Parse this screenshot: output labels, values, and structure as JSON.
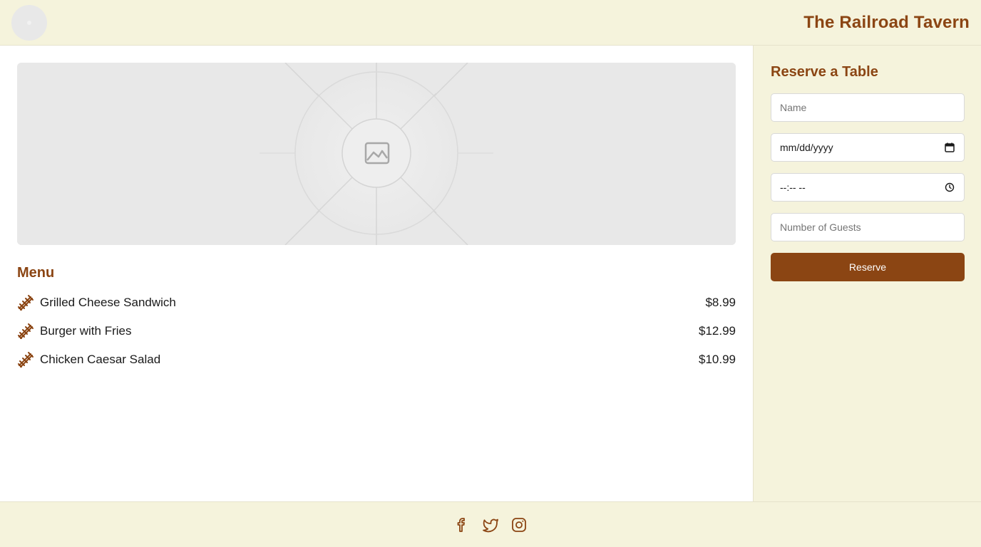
{
  "header": {
    "title": "The Railroad Tavern",
    "logo_icon": "logo-placeholder-icon"
  },
  "hero": {
    "icon": "image-placeholder-icon"
  },
  "menu": {
    "title": "Menu",
    "item_icon": "railroad-track-icon",
    "items": [
      {
        "name": "Grilled Cheese Sandwich",
        "price": "$8.99"
      },
      {
        "name": "Burger with Fries",
        "price": "$12.99"
      },
      {
        "name": "Chicken Caesar Salad",
        "price": "$10.99"
      }
    ]
  },
  "reservation": {
    "title": "Reserve a Table",
    "name_placeholder": "Name",
    "date_value": "mm/dd/yyyy",
    "time_value": "--:-- --",
    "guests_placeholder": "Number of Guests",
    "submit_label": "Reserve"
  },
  "footer": {
    "social": [
      "facebook-icon",
      "twitter-icon",
      "instagram-icon"
    ]
  },
  "colors": {
    "brand": "#8b4513",
    "background_cream": "#f5f3dc",
    "placeholder_gray": "#e8e8e8"
  }
}
